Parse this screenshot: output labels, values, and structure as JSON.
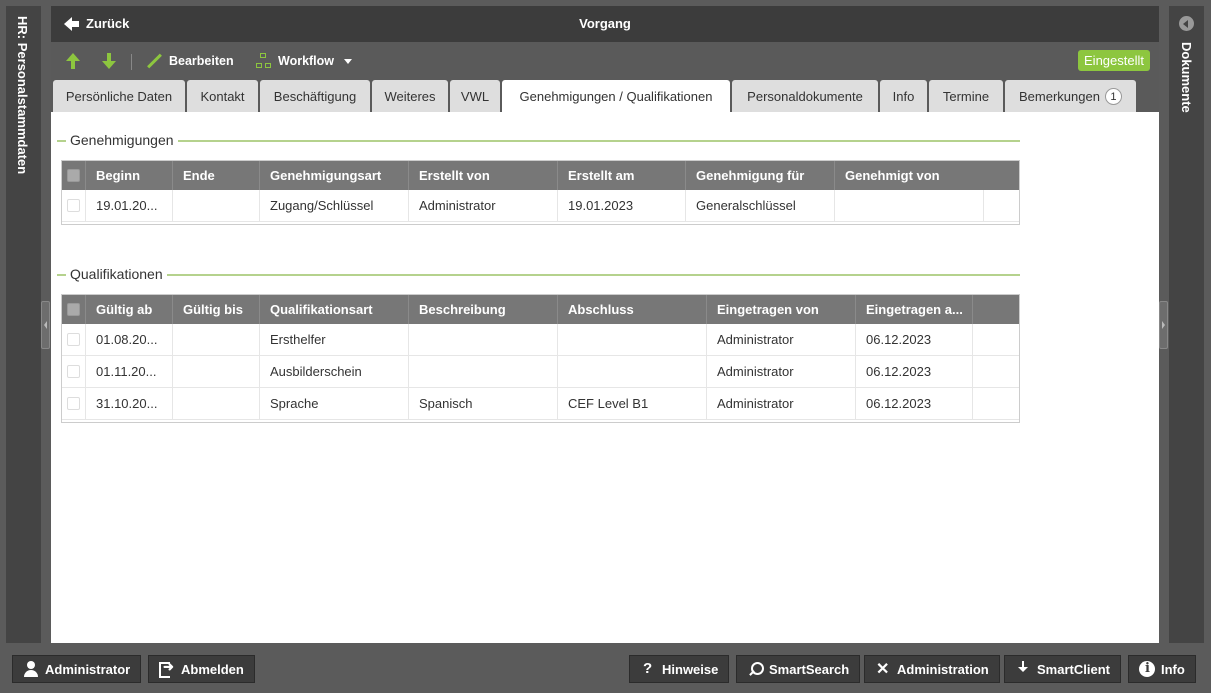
{
  "left_panel": {
    "label": "HR: Personalstammdaten"
  },
  "right_panel": {
    "label": "Dokumente"
  },
  "titlebar": {
    "back_label": "Zurück",
    "title": "Vorgang"
  },
  "toolbar": {
    "edit_label": "Bearbeiten",
    "workflow_label": "Workflow",
    "status": "Eingestellt"
  },
  "tabs": [
    {
      "label": "Persönliche Daten"
    },
    {
      "label": "Kontakt"
    },
    {
      "label": "Beschäftigung"
    },
    {
      "label": "Weiteres"
    },
    {
      "label": "VWL"
    },
    {
      "label": "Genehmigungen / Qualifikationen",
      "active": true
    },
    {
      "label": "Personaldokumente"
    },
    {
      "label": "Info"
    },
    {
      "label": "Termine"
    },
    {
      "label": "Bemerkungen",
      "badge": "1"
    }
  ],
  "genehmigungen": {
    "legend": "Genehmigungen",
    "columns": [
      "Beginn",
      "Ende",
      "Genehmigungsart",
      "Erstellt von",
      "Erstellt am",
      "Genehmigung für",
      "Genehmigt von"
    ],
    "rows": [
      [
        "19.01.20...",
        "",
        "Zugang/Schlüssel",
        "Administrator",
        "19.01.2023",
        "Generalschlüssel",
        ""
      ]
    ]
  },
  "qualifikationen": {
    "legend": "Qualifikationen",
    "columns": [
      "Gültig ab",
      "Gültig bis",
      "Qualifikationsart",
      "Beschreibung",
      "Abschluss",
      "Eingetragen von",
      "Eingetragen a..."
    ],
    "rows": [
      [
        "01.08.20...",
        "",
        "Ersthelfer",
        "",
        "",
        "Administrator",
        "06.12.2023"
      ],
      [
        "01.11.20...",
        "",
        "Ausbilderschein",
        "",
        "",
        "Administrator",
        "06.12.2023"
      ],
      [
        "31.10.20...",
        "",
        "Sprache",
        "Spanisch",
        "CEF Level B1",
        "Administrator",
        "06.12.2023"
      ]
    ]
  },
  "bottombar": {
    "user": "Administrator",
    "logout": "Abmelden",
    "hints": "Hinweise",
    "smartsearch": "SmartSearch",
    "administration": "Administration",
    "smartclient": "SmartClient",
    "info": "Info"
  },
  "colors": {
    "accent": "#8dc63f",
    "header_bg": "#3c3c3c",
    "grid_header": "#777777"
  }
}
